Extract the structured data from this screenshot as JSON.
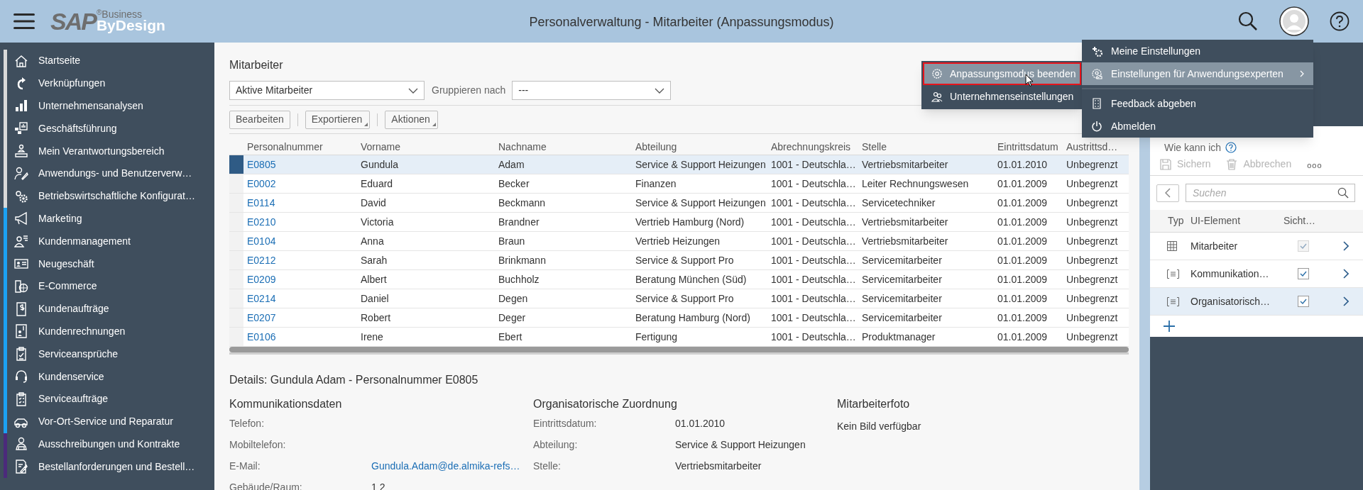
{
  "header": {
    "logo": {
      "brand": "SAP",
      "mark": "®",
      "line1": "Business",
      "line2": "ByDesign"
    },
    "title": "Personalverwaltung - Mitarbeiter (Anpassungsmodus)"
  },
  "sidebar": {
    "items": [
      {
        "label": "Startseite",
        "color": "#d9d9d9"
      },
      {
        "label": "Verknüpfungen",
        "color": "#d9d9d9"
      },
      {
        "label": "Unternehmensanalysen",
        "color": "#d9d9d9"
      },
      {
        "label": "Geschäftsführung",
        "color": "#d9d9d9"
      },
      {
        "label": "Mein Verantwortungsbereich",
        "color": "#d9d9d9"
      },
      {
        "label": "Anwendungs- und Benutzerverw…",
        "color": "#d9d9d9"
      },
      {
        "label": "Betriebswirtschaftliche Konfigurat…",
        "color": "#d9d9d9"
      },
      {
        "label": "Marketing",
        "color": "#1ba1f2"
      },
      {
        "label": "Kundenmanagement",
        "color": "#1ba1f2"
      },
      {
        "label": "Neugeschäft",
        "color": "#1ba1f2"
      },
      {
        "label": "E-Commerce",
        "color": "#1ba1f2"
      },
      {
        "label": "Kundenaufträge",
        "color": "#1ba1f2"
      },
      {
        "label": "Kundenrechnungen",
        "color": "#1ba1f2"
      },
      {
        "label": "Serviceansprüche",
        "color": "#1ba1f2"
      },
      {
        "label": "Kundenservice",
        "color": "#1ba1f2"
      },
      {
        "label": "Serviceaufträge",
        "color": "#1ba1f2"
      },
      {
        "label": "Vor-Ort-Service und Reparatur",
        "color": "#1ba1f2"
      },
      {
        "label": "Ausschreibungen und Kontrakte",
        "color": "#4b2a7b"
      },
      {
        "label": "Bestellanforderungen und Bestell…",
        "color": "#4b2a7b"
      }
    ]
  },
  "main": {
    "title": "Mitarbeiter",
    "view_select": {
      "value": "Aktive Mitarbeiter"
    },
    "group_label": "Gruppieren nach",
    "group_select": {
      "value": "---"
    },
    "toolbar": [
      {
        "label": "Bearbeiten",
        "dropdown": false
      },
      {
        "label": "Exportieren",
        "dropdown": true
      },
      {
        "label": "Aktionen",
        "dropdown": true
      }
    ],
    "table": {
      "columns": [
        "Personalnummer",
        "Vorname",
        "Nachname",
        "Abteilung",
        "Abrechnungskreis",
        "Stelle",
        "Eintrittsdatum",
        "Austrittsd…"
      ],
      "rows": [
        {
          "selected": true,
          "cells": [
            "E0805",
            "Gundula",
            "Adam",
            "Service & Support Heizungen",
            "1001 - Deutschla…",
            "Vertriebsmitarbeiter",
            "01.01.2010",
            "Unbegrenzt"
          ]
        },
        {
          "selected": false,
          "cells": [
            "E0002",
            "Eduard",
            "Becker",
            "Finanzen",
            "1001 - Deutschla…",
            "Leiter Rechnungswesen",
            "01.01.2009",
            "Unbegrenzt"
          ]
        },
        {
          "selected": false,
          "cells": [
            "E0114",
            "David",
            "Beckmann",
            "Service & Support Heizungen",
            "1001 - Deutschla…",
            "Servicetechniker",
            "01.01.2009",
            "Unbegrenzt"
          ]
        },
        {
          "selected": false,
          "cells": [
            "E0210",
            "Victoria",
            "Brandner",
            "Vertrieb Hamburg (Nord)",
            "1001 - Deutschla…",
            "Vertriebsmitarbeiter",
            "01.01.2009",
            "Unbegrenzt"
          ]
        },
        {
          "selected": false,
          "cells": [
            "E0104",
            "Anna",
            "Braun",
            "Vertrieb Heizungen",
            "1001 - Deutschla…",
            "Vertriebsmitarbeiter",
            "01.01.2009",
            "Unbegrenzt"
          ]
        },
        {
          "selected": false,
          "cells": [
            "E0212",
            "Sarah",
            "Brinkmann",
            "Service & Support Pro",
            "1001 - Deutschla…",
            "Servicemitarbeiter",
            "01.01.2009",
            "Unbegrenzt"
          ]
        },
        {
          "selected": false,
          "cells": [
            "E0209",
            "Albert",
            "Buchholz",
            "Beratung München (Süd)",
            "1001 - Deutschla…",
            "Servicemitarbeiter",
            "01.01.2009",
            "Unbegrenzt"
          ]
        },
        {
          "selected": false,
          "cells": [
            "E0214",
            "Daniel",
            "Degen",
            "Service & Support Pro",
            "1001 - Deutschla…",
            "Servicemitarbeiter",
            "01.01.2009",
            "Unbegrenzt"
          ]
        },
        {
          "selected": false,
          "cells": [
            "E0207",
            "Robert",
            "Deger",
            "Beratung Hamburg (Nord)",
            "1001 - Deutschla…",
            "Servicemitarbeiter",
            "01.01.2009",
            "Unbegrenzt"
          ]
        },
        {
          "selected": false,
          "cells": [
            "E0106",
            "Irene",
            "Ebert",
            "Fertigung",
            "1001 - Deutschla…",
            "Produktmanager",
            "01.01.2009",
            "Unbegrenzt"
          ]
        }
      ]
    }
  },
  "details": {
    "title": "Details: Gundula Adam - Personalnummer E0805",
    "sections": [
      {
        "heading": "Kommunikationsdaten",
        "fields": [
          {
            "label": "Telefon:"
          },
          {
            "label": "Mobiltelefon:"
          },
          {
            "label": "E-Mail:",
            "value": "Gundula.Adam@de.almika-refs…",
            "kind": "link"
          },
          {
            "label": "Gebäude/Raum:",
            "value": "1 2",
            "kind": "text"
          }
        ]
      },
      {
        "heading": "Organisatorische Zuordnung",
        "fields": [
          {
            "label": "Eintrittsdatum:",
            "value": "01.01.2010",
            "kind": "text"
          },
          {
            "label": "Abteilung:",
            "value": "Service & Support Heizungen",
            "kind": "text"
          },
          {
            "label": "Stelle:",
            "value": "Vertriebsmitarbeiter",
            "kind": "text"
          }
        ]
      },
      {
        "heading": "Mitarbeiterfoto",
        "note": "Kein Bild verfügbar"
      }
    ]
  },
  "right_panel": {
    "help_text": "Wie kann ich",
    "actions": [
      {
        "label": "Sichern",
        "disabled": true
      },
      {
        "label": "Abbrechen",
        "disabled": true
      }
    ],
    "more": "ooo",
    "search": {
      "placeholder": "Suchen"
    },
    "columns": [
      "Typ",
      "UI-Element",
      "Sicht…"
    ],
    "rows": [
      {
        "kind": "table",
        "label": "Mitarbeiter",
        "checked": true,
        "disabled": true,
        "selected": false
      },
      {
        "kind": "section",
        "label": "Kommunikation…",
        "checked": true,
        "disabled": false,
        "selected": false
      },
      {
        "kind": "section",
        "label": "Organisatorisch…",
        "checked": true,
        "disabled": false,
        "selected": true
      }
    ]
  },
  "user_menu": {
    "items": [
      {
        "label": "Meine Einstellungen",
        "selected": false,
        "submenu": false
      },
      {
        "label": "Einstellungen für Anwendungsexperten",
        "selected": true,
        "submenu": true
      },
      {
        "label": "Feedback abgeben",
        "selected": false,
        "submenu": false
      },
      {
        "label": "Abmelden",
        "selected": false,
        "submenu": false
      }
    ]
  },
  "submenu": {
    "items": [
      {
        "label": "Anpassungsmodus beenden",
        "selected": true,
        "outlined": true
      },
      {
        "label": "Unternehmenseinstellungen",
        "selected": false,
        "outlined": false
      }
    ]
  }
}
